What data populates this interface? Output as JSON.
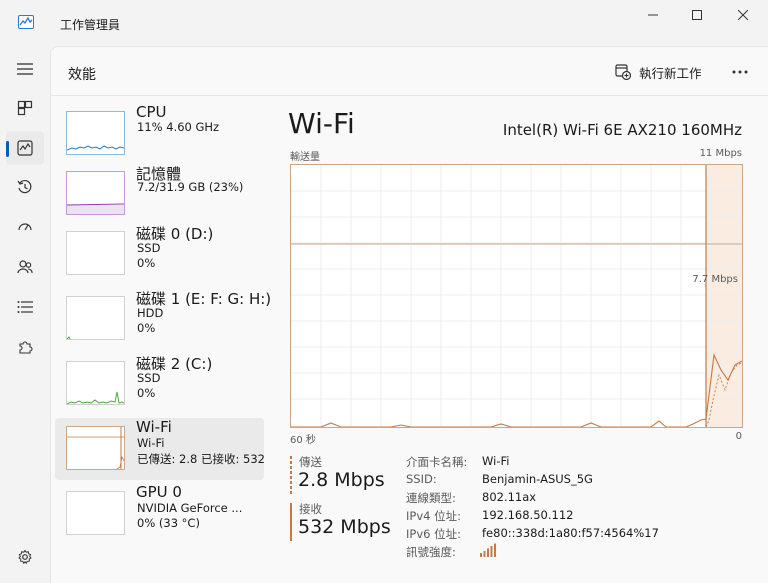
{
  "window": {
    "title": "工作管理員",
    "minimize_icon": "minimize-icon",
    "maximize_icon": "maximize-icon",
    "close_icon": "close-icon"
  },
  "header": {
    "title": "效能",
    "run_task_label": "執行新工作"
  },
  "resources": [
    {
      "name": "CPU",
      "sub1": "11%  4.60 GHz",
      "sub2": "",
      "sub3": ""
    },
    {
      "name": "記憶體",
      "sub1": "7.2/31.9 GB (23%)",
      "sub2": "",
      "sub3": ""
    },
    {
      "name": "磁碟 0 (D:)",
      "sub1": "SSD",
      "sub2": "0%",
      "sub3": ""
    },
    {
      "name": "磁碟 1 (E: F: G: H:)",
      "sub1": "HDD",
      "sub2": "0%",
      "sub3": ""
    },
    {
      "name": "磁碟 2 (C:)",
      "sub1": "SSD",
      "sub2": "0%",
      "sub3": ""
    },
    {
      "name": "Wi-Fi",
      "sub1": "Wi-Fi",
      "sub2": "已傳送: 2.8  已接收: 532",
      "sub3": ""
    },
    {
      "name": "GPU 0",
      "sub1": "NVIDIA GeForce ...",
      "sub2": "0% (33 °C)",
      "sub3": ""
    }
  ],
  "detail": {
    "title": "Wi-Fi",
    "adapter": "Intel(R) Wi-Fi 6E AX210 160MHz",
    "chart_label": "輸送量",
    "max_label": "11 Mbps",
    "mid_label": "7.7 Mbps",
    "time_label": "60 秒",
    "zero_label": "0",
    "send_label": "傳送",
    "send_value": "2.8 Mbps",
    "recv_label": "接收",
    "recv_value": "532 Mbps",
    "properties": [
      {
        "label": "介面卡名稱:",
        "value": "Wi-Fi"
      },
      {
        "label": "SSID:",
        "value": "Benjamin-ASUS_5G"
      },
      {
        "label": "連線類型:",
        "value": "802.11ax"
      },
      {
        "label": "IPv4 位址:",
        "value": "192.168.50.112"
      },
      {
        "label": "IPv6 位址:",
        "value": "fe80::338d:1a80:f57:4564%17"
      },
      {
        "label": "訊號強度:",
        "value": ""
      }
    ]
  },
  "colors": {
    "accent": "#005fb8",
    "wifi": "#c37a43",
    "cpu": "#1f7fc4",
    "memory": "#8e3ea8",
    "disk_ssd": "#4ba93b"
  }
}
